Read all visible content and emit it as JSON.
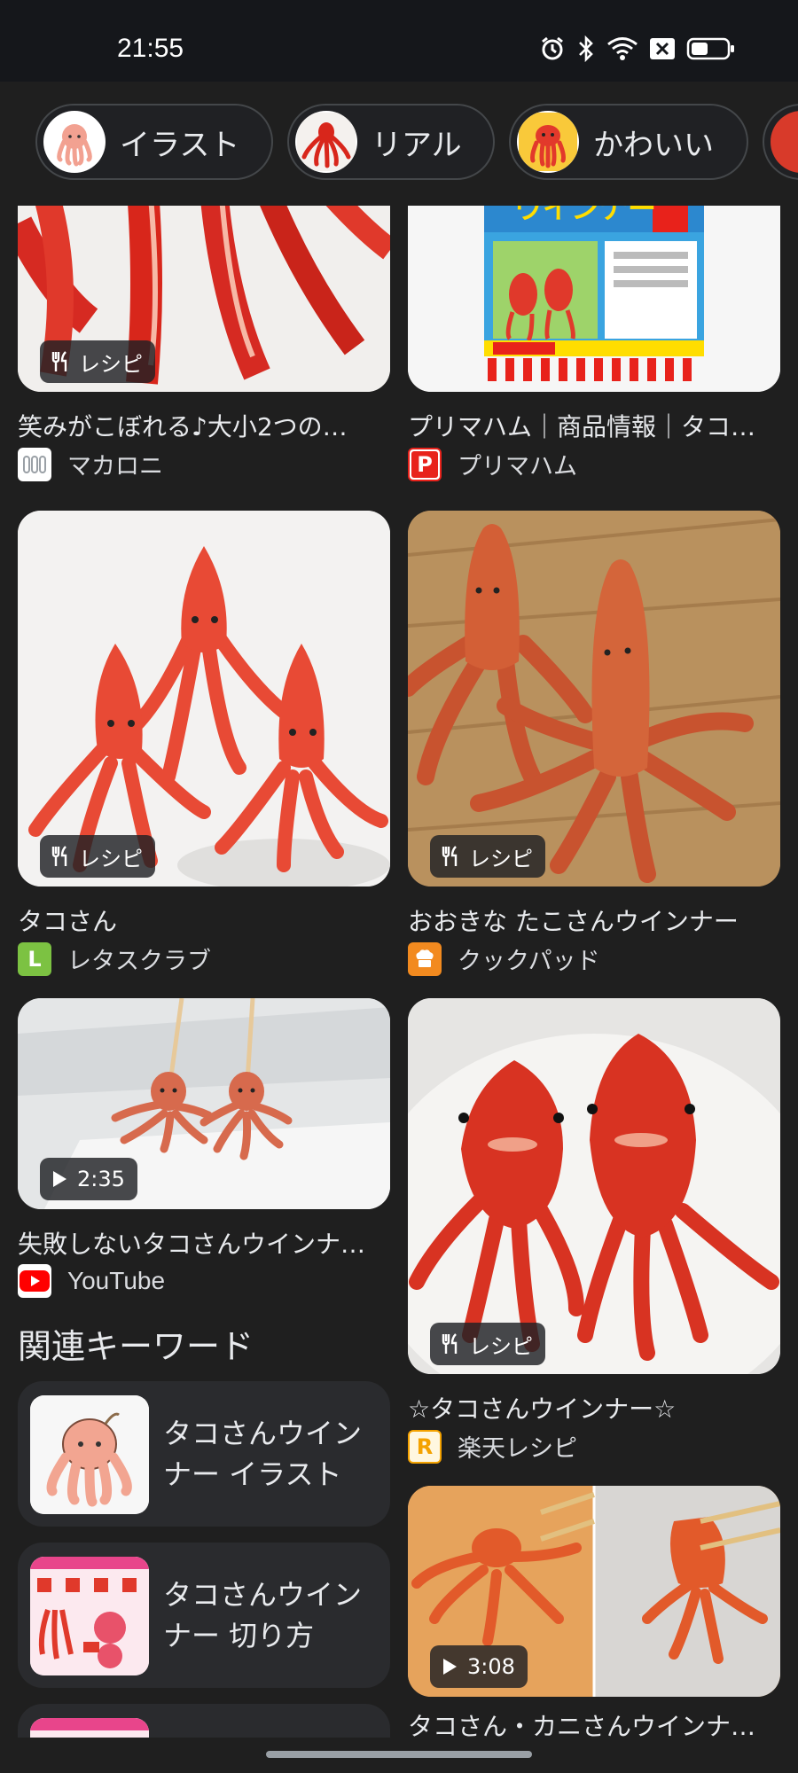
{
  "status_bar": {
    "time": "21:55",
    "icons": [
      "alarm-icon",
      "bluetooth-icon",
      "wifi-icon",
      "no-sim-icon",
      "battery-icon"
    ]
  },
  "chips": [
    {
      "label": "イラスト",
      "icon": "octopus-illustration-thumb"
    },
    {
      "label": "リアル",
      "icon": "octopus-real-thumb"
    },
    {
      "label": "かわいい",
      "icon": "octopus-cute-thumb"
    }
  ],
  "results": {
    "card1": {
      "badge": "レシピ",
      "title": "笑みがこぼれる♪大小2つの…",
      "source": "マカロニ"
    },
    "card2": {
      "title": "プリマハム｜商品情報｜タコ…",
      "source": "プリマハム",
      "package_text": "ウインナー"
    },
    "card3": {
      "badge": "レシピ",
      "title": "タコさん",
      "source": "レタスクラブ"
    },
    "card4": {
      "badge": "レシピ",
      "title": "おおきな たこさんウインナー",
      "source": "クックパッド"
    },
    "card5": {
      "duration": "2:35",
      "title": "失敗しないタコさんウインナ…",
      "source": "YouTube"
    },
    "card6": {
      "badge": "レシピ",
      "title": "☆タコさんウインナー☆",
      "source": "楽天レシピ"
    },
    "card7": {
      "duration": "3:08",
      "title": "タコさん・カニさんウインナ…"
    }
  },
  "related": {
    "heading": "関連キーワード",
    "items": [
      {
        "text": "タコさんウインナー イラスト"
      },
      {
        "text": "タコさんウインナー 切り方"
      }
    ]
  },
  "colors": {
    "background": "#1f1f1f",
    "status_bar": "#15171b",
    "sausage_red": "#e0392b",
    "letasclub_green": "#7cc242",
    "cookpad_orange": "#f28a1f",
    "youtube_red": "#ff0000",
    "rakuten_orange": "#f4a200",
    "primaham_red": "#e8221b"
  }
}
